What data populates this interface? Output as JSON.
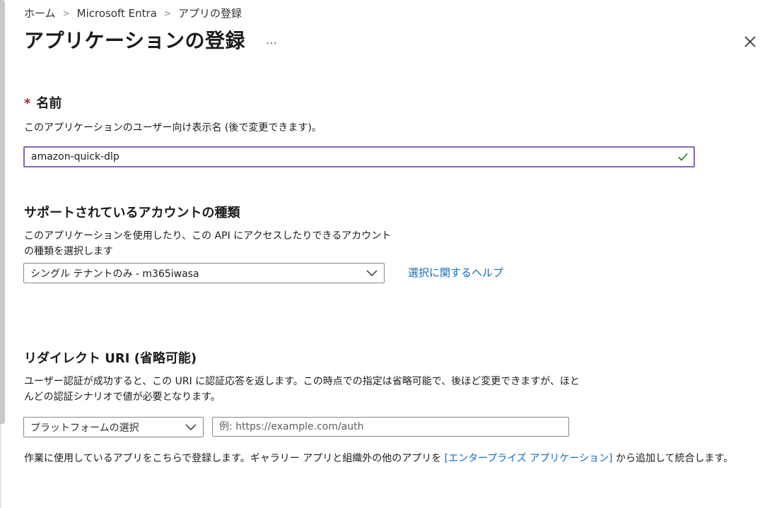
{
  "breadcrumb": {
    "items": [
      "ホーム",
      "Microsoft Entra",
      "アプリの登録"
    ]
  },
  "header": {
    "title": "アプリケーションの登録",
    "more_label": "…"
  },
  "name_section": {
    "required_mark": "*",
    "label": "名前",
    "description": "このアプリケーションのユーザー向け表示名 (後で変更できます)。",
    "input_value": "amazon-quick-dlp"
  },
  "account_section": {
    "label": "サポートされているアカウントの種類",
    "description_line1": "このアプリケーションを使用したり、この API にアクセスしたりできるアカウント",
    "description_line2": "の種類を選択します",
    "selected_value": "シングル テナントのみ - m365iwasa",
    "help_link": "選択に関するヘルプ"
  },
  "redirect_section": {
    "label": "リダイレクト URI (省略可能)",
    "description_line1": "ユーザー認証が成功すると、この URI に認証応答を返します。この時点での指定は省略可能で、後ほど変更できますが、ほと",
    "description_line2": "んどの認証シナリオで値が必要となります。",
    "platform_placeholder": "プラットフォームの選択",
    "uri_placeholder": "例: https://example.com/auth"
  },
  "footer": {
    "text_before": "作業に使用しているアプリをこちらで登録します。ギャラリー アプリと組織外の他のアプリを ",
    "link": "[エンタープライズ アプリケーション]",
    "text_after": " から追加して統合します。"
  },
  "colors": {
    "accent_link": "#0f6cbd",
    "input_focus_border": "#8764b8",
    "check_green": "#107c10",
    "required_red": "#a4262c"
  }
}
